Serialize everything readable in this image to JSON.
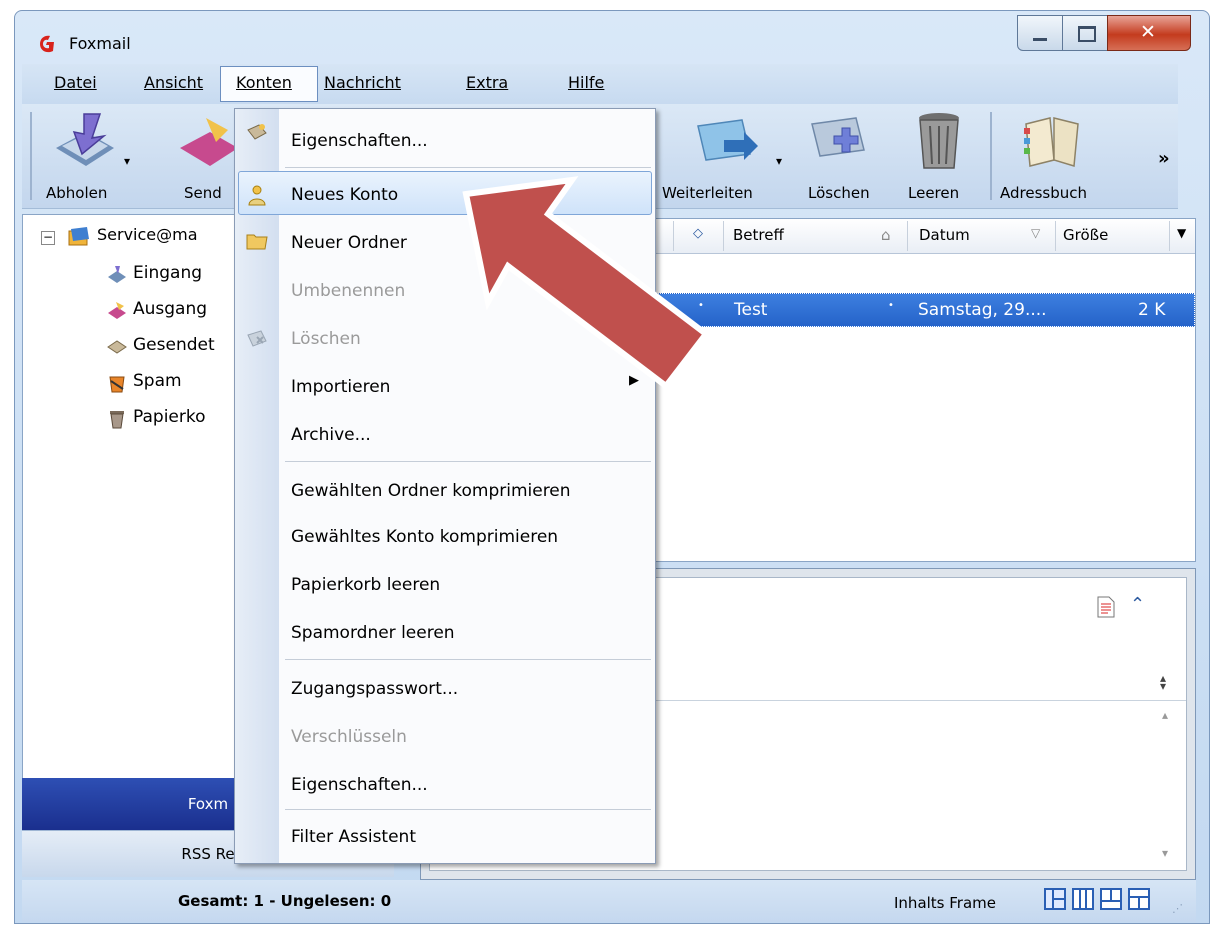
{
  "window": {
    "title": "Foxmail"
  },
  "menubar": {
    "items": [
      {
        "label": "Datei"
      },
      {
        "label": "Ansicht"
      },
      {
        "label": "Konten"
      },
      {
        "label": "Nachricht"
      },
      {
        "label": "Extra"
      },
      {
        "label": "Hilfe"
      }
    ]
  },
  "toolbar": {
    "buttons": [
      {
        "label": "Abholen"
      },
      {
        "label": "Send"
      },
      {
        "label": "Weiterleiten"
      },
      {
        "label": "Löschen"
      },
      {
        "label": "Leeren"
      },
      {
        "label": "Adressbuch"
      }
    ],
    "overflow": "»"
  },
  "tree": {
    "account": "Service@ma",
    "folders": [
      {
        "label": "Eingang"
      },
      {
        "label": "Ausgang"
      },
      {
        "label": "Gesendet"
      },
      {
        "label": "Spam"
      },
      {
        "label": "Papierko"
      }
    ]
  },
  "nav": {
    "foxmail": "Foxm",
    "rss": "RSS Re"
  },
  "message_list": {
    "columns": [
      "Betreff",
      "Datum",
      "Größe"
    ],
    "rows": [
      {
        "subject": "Test",
        "date": "Samstag, 29....",
        "size": "2 K"
      }
    ]
  },
  "konten_menu": {
    "items": [
      {
        "label": "Eigenschaften...",
        "disabled": false
      },
      {
        "label": "Neues Konto",
        "disabled": false
      },
      {
        "label": "Neuer Ordner",
        "disabled": false
      },
      {
        "label": "Umbenennen",
        "disabled": true
      },
      {
        "label": "Löschen",
        "disabled": true
      },
      {
        "label": "Importieren",
        "disabled": false
      },
      {
        "label": "Archive...",
        "disabled": false
      },
      {
        "label": "Gewählten Ordner komprimieren",
        "disabled": false
      },
      {
        "label": "Gewähltes Konto komprimieren",
        "disabled": false
      },
      {
        "label": "Papierkorb leeren",
        "disabled": false
      },
      {
        "label": "Spamordner leeren",
        "disabled": false
      },
      {
        "label": "Zugangspasswort...",
        "disabled": false
      },
      {
        "label": "Verschlüsseln",
        "disabled": true
      },
      {
        "label": "Eigenschaften...",
        "disabled": false
      },
      {
        "label": "Filter Assistent",
        "disabled": false
      }
    ],
    "highlighted": "Neues Konto"
  },
  "statusbar": {
    "totals": "Gesamt: 1 - Ungelesen: 0",
    "frame_label": "Inhalts Frame"
  },
  "colors": {
    "highlight_arrow": "#c0504d",
    "selection": "#2f6fd6",
    "nav_active": "#223a9c"
  }
}
